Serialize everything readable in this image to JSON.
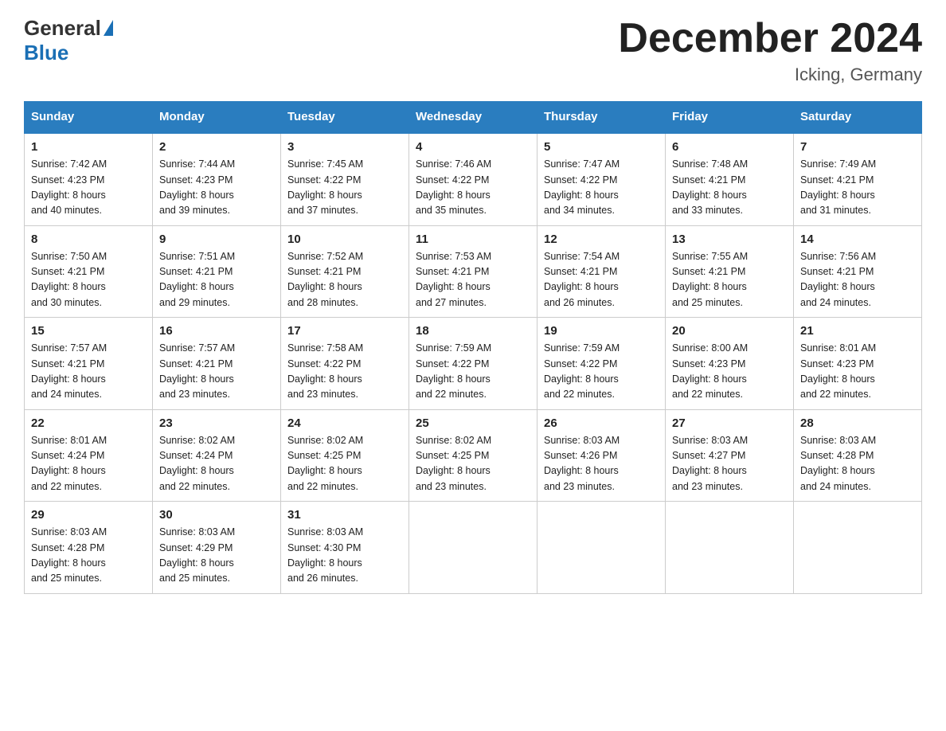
{
  "logo": {
    "general": "General",
    "blue": "Blue"
  },
  "title": {
    "month_year": "December 2024",
    "location": "Icking, Germany"
  },
  "headers": [
    "Sunday",
    "Monday",
    "Tuesday",
    "Wednesday",
    "Thursday",
    "Friday",
    "Saturday"
  ],
  "weeks": [
    [
      {
        "day": "1",
        "sunrise": "7:42 AM",
        "sunset": "4:23 PM",
        "daylight": "8 hours and 40 minutes."
      },
      {
        "day": "2",
        "sunrise": "7:44 AM",
        "sunset": "4:23 PM",
        "daylight": "8 hours and 39 minutes."
      },
      {
        "day": "3",
        "sunrise": "7:45 AM",
        "sunset": "4:22 PM",
        "daylight": "8 hours and 37 minutes."
      },
      {
        "day": "4",
        "sunrise": "7:46 AM",
        "sunset": "4:22 PM",
        "daylight": "8 hours and 35 minutes."
      },
      {
        "day": "5",
        "sunrise": "7:47 AM",
        "sunset": "4:22 PM",
        "daylight": "8 hours and 34 minutes."
      },
      {
        "day": "6",
        "sunrise": "7:48 AM",
        "sunset": "4:21 PM",
        "daylight": "8 hours and 33 minutes."
      },
      {
        "day": "7",
        "sunrise": "7:49 AM",
        "sunset": "4:21 PM",
        "daylight": "8 hours and 31 minutes."
      }
    ],
    [
      {
        "day": "8",
        "sunrise": "7:50 AM",
        "sunset": "4:21 PM",
        "daylight": "8 hours and 30 minutes."
      },
      {
        "day": "9",
        "sunrise": "7:51 AM",
        "sunset": "4:21 PM",
        "daylight": "8 hours and 29 minutes."
      },
      {
        "day": "10",
        "sunrise": "7:52 AM",
        "sunset": "4:21 PM",
        "daylight": "8 hours and 28 minutes."
      },
      {
        "day": "11",
        "sunrise": "7:53 AM",
        "sunset": "4:21 PM",
        "daylight": "8 hours and 27 minutes."
      },
      {
        "day": "12",
        "sunrise": "7:54 AM",
        "sunset": "4:21 PM",
        "daylight": "8 hours and 26 minutes."
      },
      {
        "day": "13",
        "sunrise": "7:55 AM",
        "sunset": "4:21 PM",
        "daylight": "8 hours and 25 minutes."
      },
      {
        "day": "14",
        "sunrise": "7:56 AM",
        "sunset": "4:21 PM",
        "daylight": "8 hours and 24 minutes."
      }
    ],
    [
      {
        "day": "15",
        "sunrise": "7:57 AM",
        "sunset": "4:21 PM",
        "daylight": "8 hours and 24 minutes."
      },
      {
        "day": "16",
        "sunrise": "7:57 AM",
        "sunset": "4:21 PM",
        "daylight": "8 hours and 23 minutes."
      },
      {
        "day": "17",
        "sunrise": "7:58 AM",
        "sunset": "4:22 PM",
        "daylight": "8 hours and 23 minutes."
      },
      {
        "day": "18",
        "sunrise": "7:59 AM",
        "sunset": "4:22 PM",
        "daylight": "8 hours and 22 minutes."
      },
      {
        "day": "19",
        "sunrise": "7:59 AM",
        "sunset": "4:22 PM",
        "daylight": "8 hours and 22 minutes."
      },
      {
        "day": "20",
        "sunrise": "8:00 AM",
        "sunset": "4:23 PM",
        "daylight": "8 hours and 22 minutes."
      },
      {
        "day": "21",
        "sunrise": "8:01 AM",
        "sunset": "4:23 PM",
        "daylight": "8 hours and 22 minutes."
      }
    ],
    [
      {
        "day": "22",
        "sunrise": "8:01 AM",
        "sunset": "4:24 PM",
        "daylight": "8 hours and 22 minutes."
      },
      {
        "day": "23",
        "sunrise": "8:02 AM",
        "sunset": "4:24 PM",
        "daylight": "8 hours and 22 minutes."
      },
      {
        "day": "24",
        "sunrise": "8:02 AM",
        "sunset": "4:25 PM",
        "daylight": "8 hours and 22 minutes."
      },
      {
        "day": "25",
        "sunrise": "8:02 AM",
        "sunset": "4:25 PM",
        "daylight": "8 hours and 23 minutes."
      },
      {
        "day": "26",
        "sunrise": "8:03 AM",
        "sunset": "4:26 PM",
        "daylight": "8 hours and 23 minutes."
      },
      {
        "day": "27",
        "sunrise": "8:03 AM",
        "sunset": "4:27 PM",
        "daylight": "8 hours and 23 minutes."
      },
      {
        "day": "28",
        "sunrise": "8:03 AM",
        "sunset": "4:28 PM",
        "daylight": "8 hours and 24 minutes."
      }
    ],
    [
      {
        "day": "29",
        "sunrise": "8:03 AM",
        "sunset": "4:28 PM",
        "daylight": "8 hours and 25 minutes."
      },
      {
        "day": "30",
        "sunrise": "8:03 AM",
        "sunset": "4:29 PM",
        "daylight": "8 hours and 25 minutes."
      },
      {
        "day": "31",
        "sunrise": "8:03 AM",
        "sunset": "4:30 PM",
        "daylight": "8 hours and 26 minutes."
      },
      null,
      null,
      null,
      null
    ]
  ],
  "labels": {
    "sunrise": "Sunrise:",
    "sunset": "Sunset:",
    "daylight": "Daylight:"
  }
}
